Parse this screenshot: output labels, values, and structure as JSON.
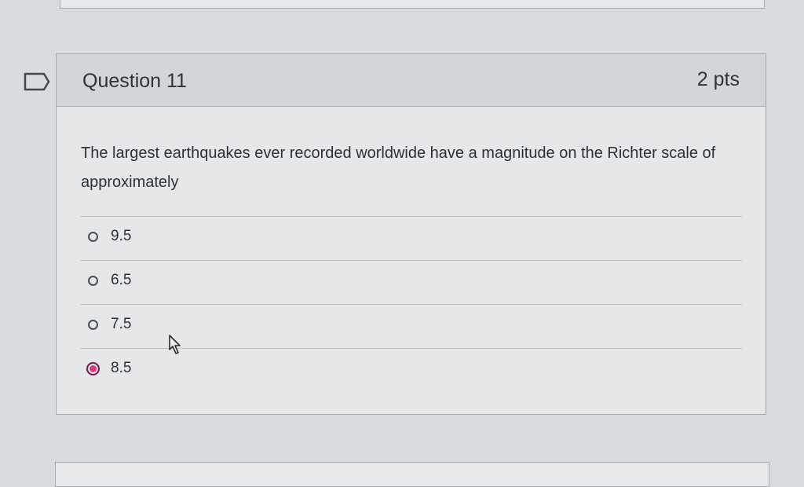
{
  "question": {
    "title": "Question 11",
    "points": "2 pts",
    "text": "The largest earthquakes ever recorded worldwide have a magnitude on the Richter scale of approximately"
  },
  "answers": [
    {
      "label": "9.5",
      "selected": false
    },
    {
      "label": "6.5",
      "selected": false
    },
    {
      "label": "7.5",
      "selected": false
    },
    {
      "label": "8.5",
      "selected": true
    }
  ],
  "colors": {
    "selected_radio": "#d13e79",
    "selected_radio_border": "#7d1a4a",
    "page_background": "#d9dcdf"
  },
  "icons": {
    "flag": "flag-outline-icon",
    "cursor": "mouse-pointer-icon"
  }
}
